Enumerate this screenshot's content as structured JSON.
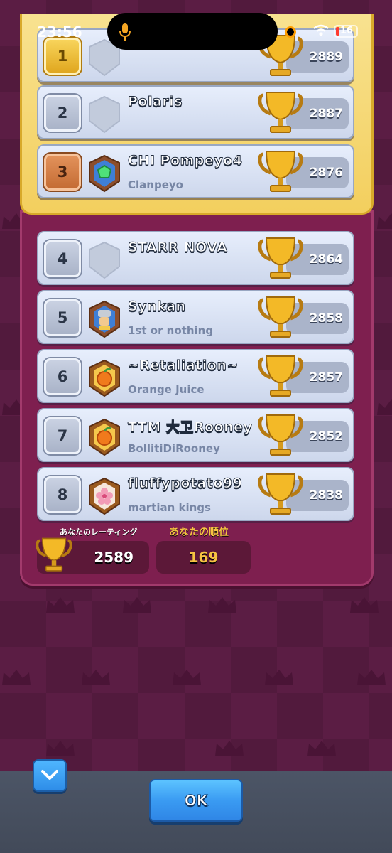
{
  "status_bar": {
    "time": "23:56",
    "battery": "16"
  },
  "leaderboard": [
    {
      "rank": "1",
      "name": "",
      "clan": "",
      "trophies": "2889",
      "badge": "empty",
      "rank_style": "gold"
    },
    {
      "rank": "2",
      "name": "Polaris",
      "clan": "",
      "trophies": "2887",
      "badge": "empty",
      "rank_style": "silver"
    },
    {
      "rank": "3",
      "name": "CHI Pompeyo4",
      "clan": "Clanpeyo",
      "trophies": "2876",
      "badge": "gem",
      "rank_style": "bronze"
    },
    {
      "rank": "4",
      "name": "STARR NOVA",
      "clan": "",
      "trophies": "2864",
      "badge": "empty",
      "rank_style": "normal"
    },
    {
      "rank": "5",
      "name": "Synkan",
      "clan": "1st or nothing",
      "trophies": "2858",
      "badge": "knight",
      "rank_style": "normal"
    },
    {
      "rank": "6",
      "name": "~Retaliation~",
      "clan": "Orange Juice",
      "trophies": "2857",
      "badge": "orange",
      "rank_style": "normal"
    },
    {
      "rank": "7",
      "name": "TTM 大卫Rooney",
      "clan": "BollitiDiRooney",
      "trophies": "2852",
      "badge": "orange",
      "rank_style": "normal"
    },
    {
      "rank": "8",
      "name": "fluffypotato99",
      "clan": "martian kings",
      "trophies": "2838",
      "badge": "flower",
      "rank_style": "normal"
    }
  ],
  "summary": {
    "rating_label": "あなたのレーティング",
    "rating_value": "2589",
    "rank_label": "あなたの順位",
    "rank_value": "169"
  },
  "buttons": {
    "ok_label": "OK"
  },
  "colors": {
    "background": "#5b1d44",
    "gold_panel": "#f3cf5e",
    "row": "#dfe6f6",
    "accent_blue": "#3a9bf2",
    "rank_text": "#f6c342"
  }
}
